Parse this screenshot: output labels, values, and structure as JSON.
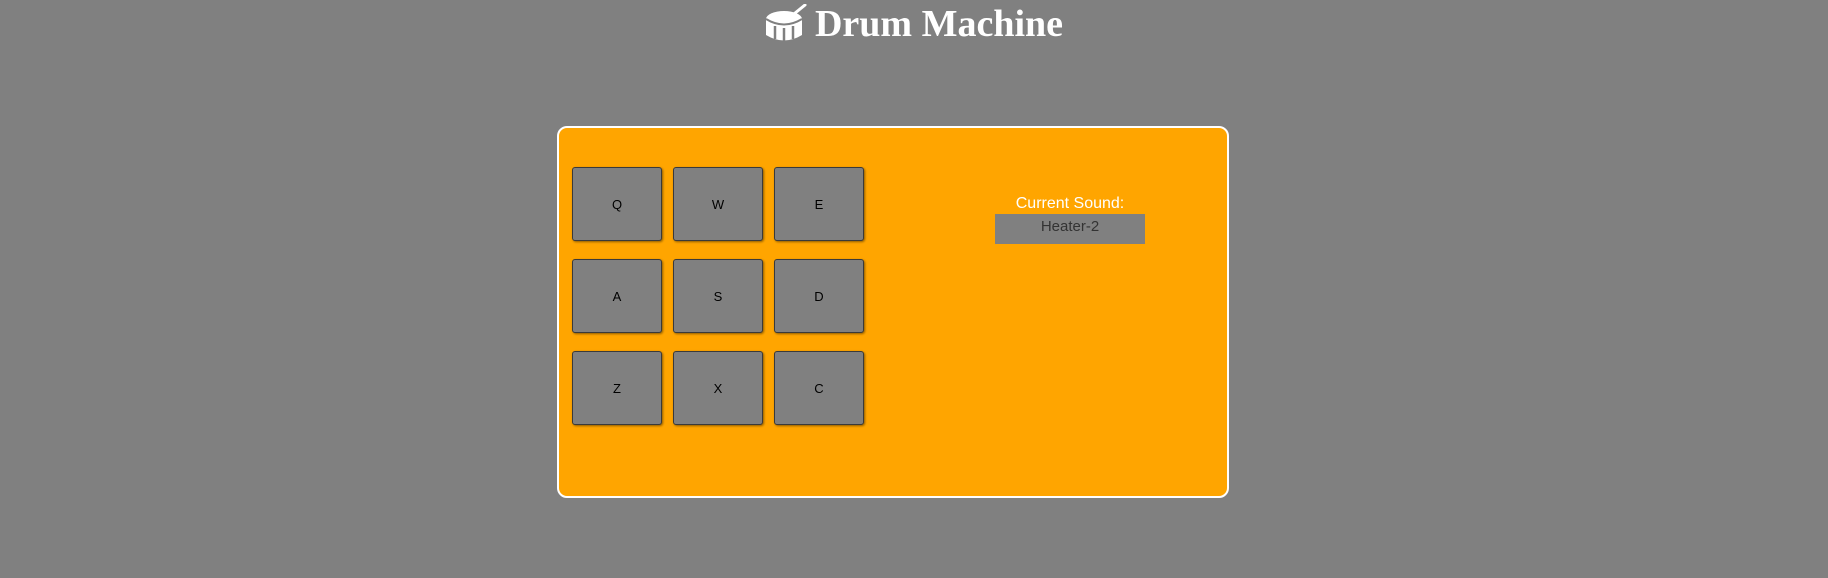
{
  "header": {
    "title": "Drum Machine",
    "icon": "drum-icon"
  },
  "pads": [
    {
      "key": "Q"
    },
    {
      "key": "W"
    },
    {
      "key": "E"
    },
    {
      "key": "A"
    },
    {
      "key": "S"
    },
    {
      "key": "D"
    },
    {
      "key": "Z"
    },
    {
      "key": "X"
    },
    {
      "key": "C"
    }
  ],
  "display": {
    "label": "Current Sound:",
    "value": "Heater-2"
  },
  "colors": {
    "background": "#808080",
    "machine": "#ffa500",
    "pad": "#808080",
    "text_light": "#ffffff"
  }
}
